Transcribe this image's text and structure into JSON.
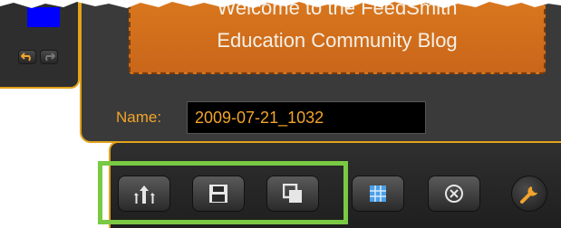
{
  "banner": {
    "line1": "Welcome to the FeedSmith",
    "line2": "Education Community Blog"
  },
  "name_field": {
    "label": "Name:",
    "value": "2009-07-21_1032"
  },
  "colors": {
    "accent_orange": "#e3a21a",
    "banner_orange": "#d9771e",
    "highlight_green": "#7ac943",
    "swatch_blue": "#0000ff"
  },
  "left_strip": {
    "swatch_icon": "color-swatch",
    "buttons": [
      "undo-icon",
      "redo-icon"
    ]
  },
  "toolbar": {
    "highlighted_buttons": [
      "share-icon",
      "save-icon",
      "copy-icon"
    ],
    "other_buttons": [
      "grid-icon",
      "close-circle-icon"
    ],
    "settings_icon": "wrench-icon"
  }
}
